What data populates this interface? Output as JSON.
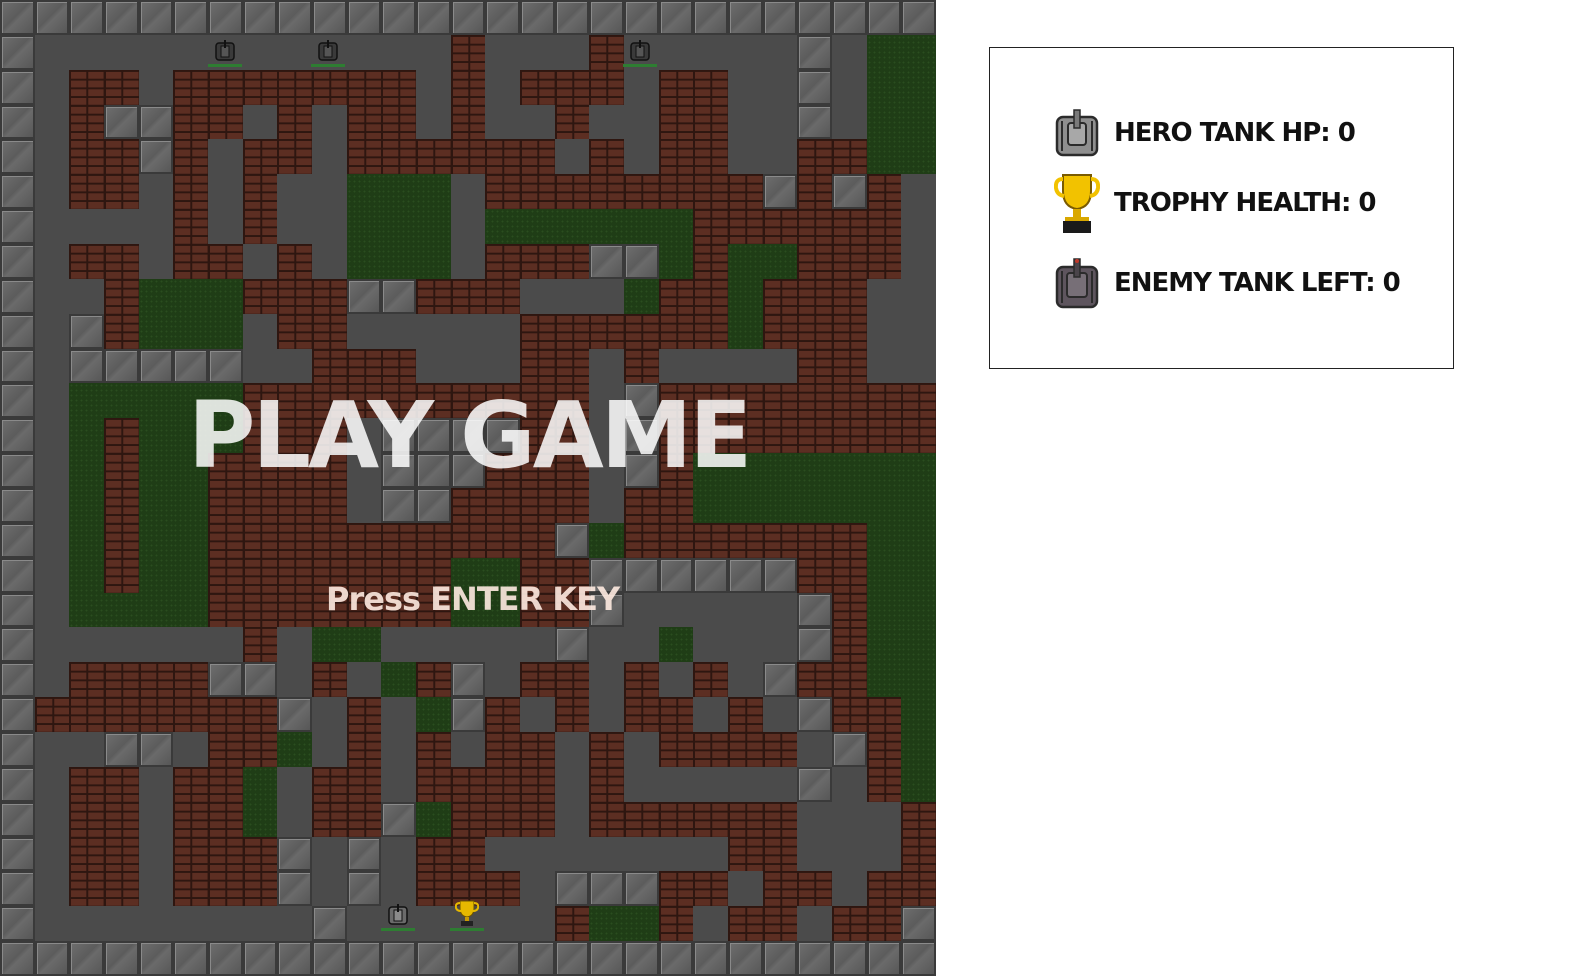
{
  "overlay": {
    "title": "PLAY GAME",
    "subtitle": "Press ENTER KEY"
  },
  "hud": {
    "hero_tank_hp_label": "HERO TANK HP: 0",
    "trophy_health_label": "TROPHY HEALTH: 0",
    "enemy_tank_left_label": "ENEMY TANK LEFT: 0",
    "hero_tank_icon": "hero-tank-icon",
    "trophy_icon": "trophy-icon",
    "enemy_tank_icon": "enemy-tank-icon"
  },
  "colors": {
    "floor": "#4b4b4b",
    "brick": "#5c2e22",
    "steel": "#6e6e6e",
    "grass": "#1f3d16",
    "trophy": "#e6b800",
    "hp_bar": "#2e7d32"
  },
  "map_legend": {
    "S": "steel-wall",
    "B": "brick-wall",
    "G": "grass",
    ".": "floor"
  },
  "map": [
    "SSSSSSSSSSSSSSSSSSSSSSSSSSS",
    "S............B...B.....S.GGS",
    "S.BB.BBBBBBB.B.BBB.BB..S.GGS",
    "S.BSSBB.B.BB.B..B..BB..S.GGS",
    "S.BBSB.BB.BBBBBB.B.BB..BBGGS",
    "S.BB.B.B..GGG.BBBBBBBBSBSB.S",
    "S....B.B..GGG.GGGGGGBBBBBB.S",
    "S.BB.BB.B.GGG.BBBSSGBGGBBB.S",
    "S..BGGGBBBSSBBB...GBBGBBB..S",
    "S.SBGGG.BB.....BBBBBBGBBB..S",
    "S.SSSSS..BBB...BB.B....BB..S",
    "S.GGGGGBBBBBBBBBB.SBBBBBBBBS",
    "S.GBGGGBBB.SSSSBB.SBBBBBBBBS",
    "S.GBGGBBBB.SSSBBB.SBGGGGGGGS",
    "S.GBGGBBBB.SSBBBB.BBGGGGGGGS",
    "S.GBGGBBBBBBBBBBSGBBBBBBBGGS",
    "S.GBGGBBBBBBBGGBBSSSSSSBBGGS",
    "S.GGGGBBBBBBBGGBBS.....SBGGS",
    "S......B.GG.....S..G...SBGGS",
    "S.BBBBSS.B.GBS.BB.B.B.SBBGGS",
    "SBBBBBBBS.B.GSB.B.BB.B.SBBGS",
    "S..SS.BBG.B.B.BB.B.BBBB.SBGS",
    "S.BB.BBG.BB.BBBB.B.....S.BGS",
    "S.BB.BBG.BBSGBBB.BBBBBB...BGS",
    "S.BB.BBBS.S.BB.......BB...BS",
    "S.BB.BBBS.S.BBB.SSSBB.BB.BBS",
    "S........S......BGGB.BB.BBS",
    "SSSSSSSSSSSSSSSSSSSSSSSSSSS"
  ]
}
